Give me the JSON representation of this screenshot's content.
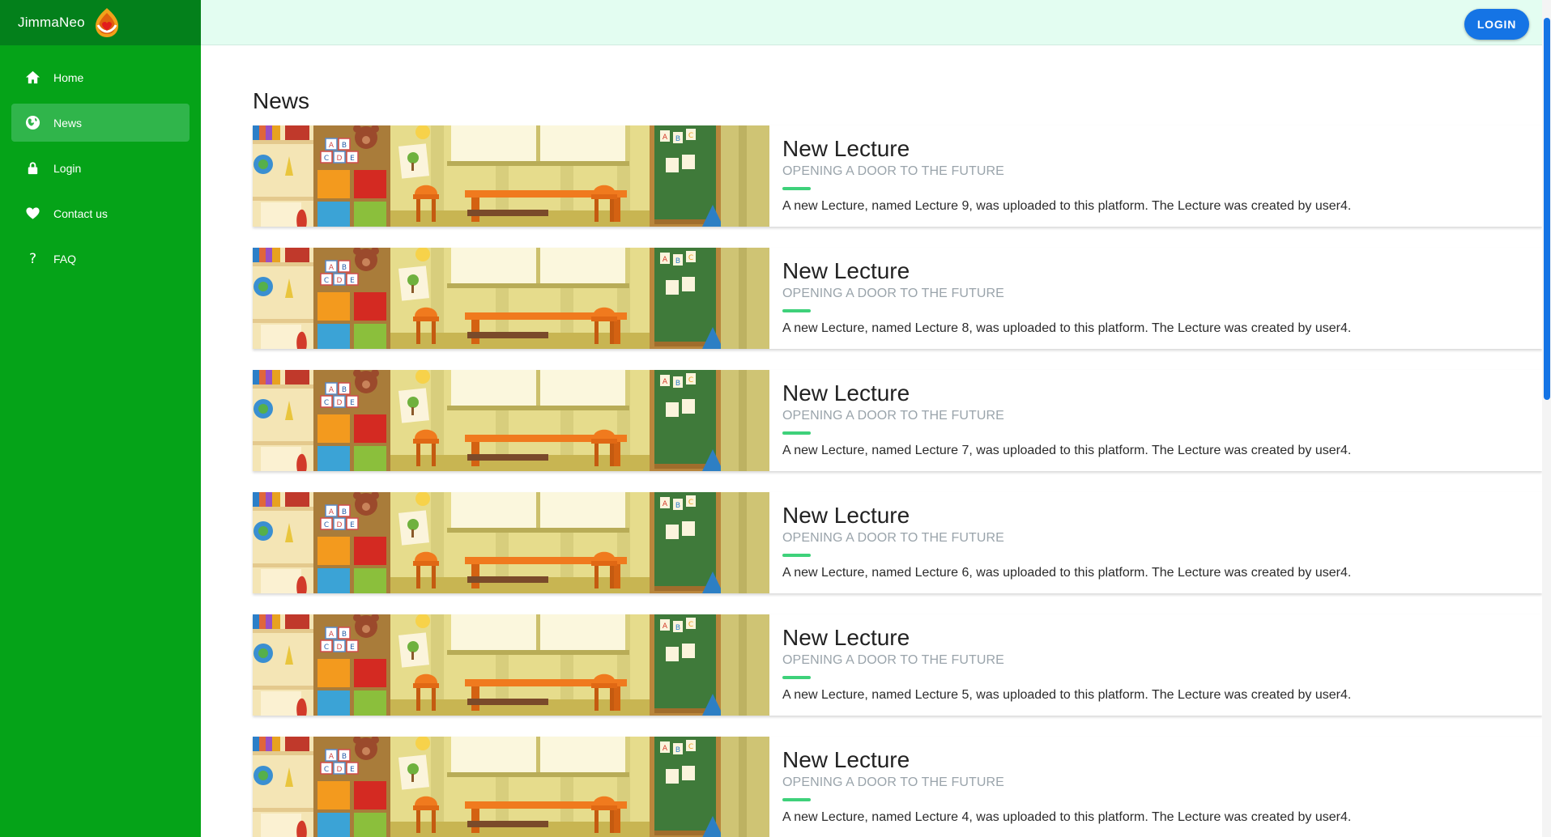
{
  "brand": {
    "name": "JimmaNeo"
  },
  "sidebar": {
    "items": [
      {
        "label": "Home",
        "icon": "home-icon"
      },
      {
        "label": "News",
        "icon": "globe-icon",
        "selected": true
      },
      {
        "label": "Login",
        "icon": "lock-icon"
      },
      {
        "label": "Contact us",
        "icon": "heart-icon"
      },
      {
        "label": "FAQ",
        "icon": "question-icon"
      }
    ]
  },
  "topbar": {
    "login_label": "LOGIN"
  },
  "main": {
    "title": "News"
  },
  "news": [
    {
      "title": "New Lecture",
      "subtitle": "OPENING A DOOR TO THE FUTURE",
      "text": "A new Lecture, named Lecture 9, was uploaded to this platform. The Lecture was created by user4."
    },
    {
      "title": "New Lecture",
      "subtitle": "OPENING A DOOR TO THE FUTURE",
      "text": "A new Lecture, named Lecture 8, was uploaded to this platform. The Lecture was created by user4."
    },
    {
      "title": "New Lecture",
      "subtitle": "OPENING A DOOR TO THE FUTURE",
      "text": "A new Lecture, named Lecture 7, was uploaded to this platform. The Lecture was created by user4."
    },
    {
      "title": "New Lecture",
      "subtitle": "OPENING A DOOR TO THE FUTURE",
      "text": "A new Lecture, named Lecture 6, was uploaded to this platform. The Lecture was created by user4."
    },
    {
      "title": "New Lecture",
      "subtitle": "OPENING A DOOR TO THE FUTURE",
      "text": "A new Lecture, named Lecture 5, was uploaded to this platform. The Lecture was created by user4."
    },
    {
      "title": "New Lecture",
      "subtitle": "OPENING A DOOR TO THE FUTURE",
      "text": "A new Lecture, named Lecture 4, was uploaded to this platform. The Lecture was created by user4."
    }
  ],
  "thumbnail": {
    "letters": [
      "A",
      "B",
      "C"
    ],
    "blocks": [
      "A",
      "B",
      "C",
      "D",
      "E"
    ]
  },
  "colors": {
    "sidebar_bg": "#05a318",
    "brand_bg": "#03801b",
    "nav_selected": "#30b54b",
    "topbar_bg": "#e3fdf1",
    "primary": "#1574e5",
    "accent_bar": "#3ed17a"
  }
}
